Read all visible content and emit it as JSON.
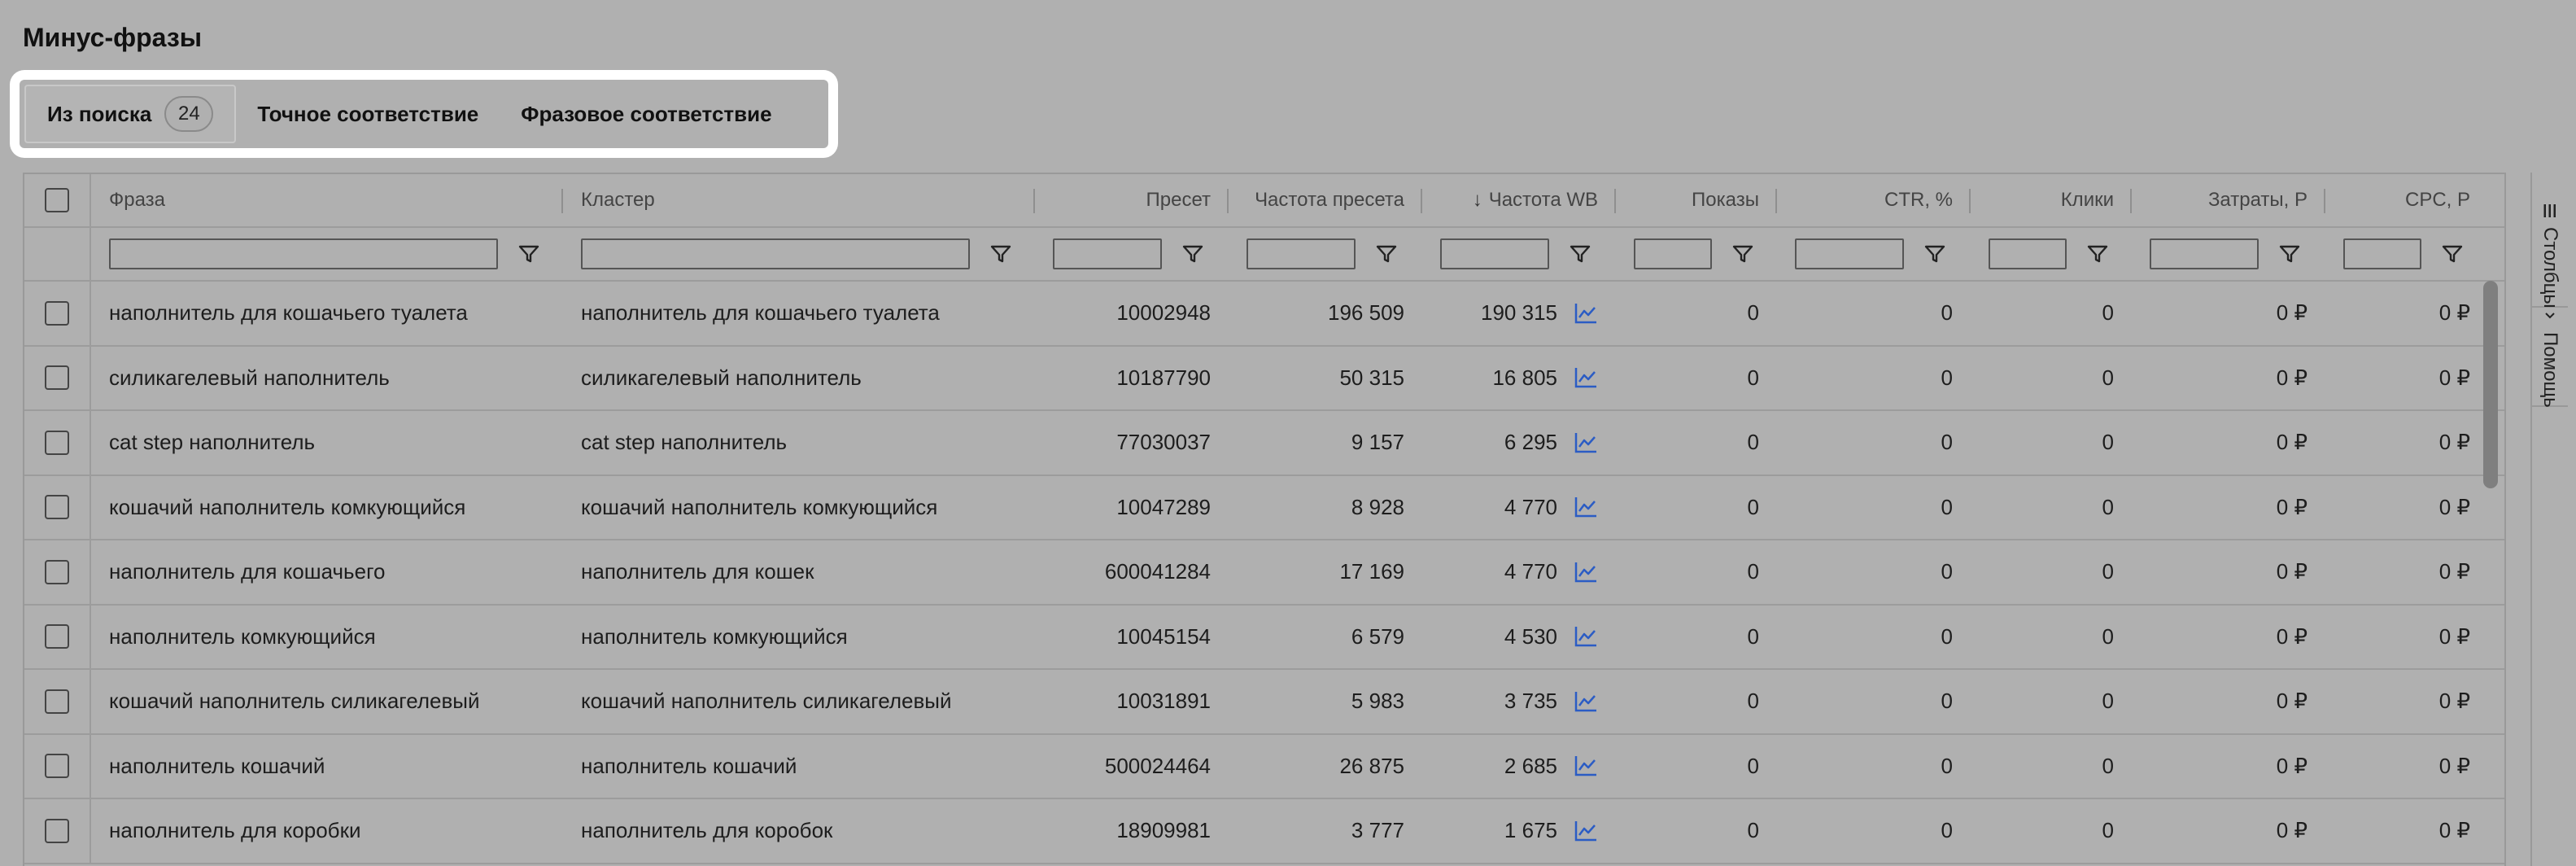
{
  "page": {
    "title": "Минус-фразы"
  },
  "tabs": [
    {
      "label": "Из поиска",
      "badge": "24",
      "active": true
    },
    {
      "label": "Точное соответствие",
      "active": false
    },
    {
      "label": "Фразовое соответствие",
      "active": false
    }
  ],
  "table": {
    "columns": [
      {
        "key": "phrase",
        "label": "Фраза"
      },
      {
        "key": "cluster",
        "label": "Кластер"
      },
      {
        "key": "preset",
        "label": "Пресет"
      },
      {
        "key": "preset_freq",
        "label": "Частота пресета"
      },
      {
        "key": "wb_freq",
        "label": "Частота WB",
        "sorted": "desc"
      },
      {
        "key": "impressions",
        "label": "Показы"
      },
      {
        "key": "ctr",
        "label": "CTR, %"
      },
      {
        "key": "clicks",
        "label": "Клики"
      },
      {
        "key": "cost",
        "label": "Затраты, Р"
      },
      {
        "key": "cpc",
        "label": "CPC, Р"
      }
    ],
    "sort_arrow": "↓",
    "rows": [
      [
        "наполнитель для кошачьего туалета",
        "наполнитель для кошачьего туалета",
        "10002948",
        "196 509",
        "190 315",
        "0",
        "0",
        "0",
        "0 ₽",
        "0 ₽"
      ],
      [
        "силикагелевый наполнитель",
        "силикагелевый наполнитель",
        "10187790",
        "50 315",
        "16 805",
        "0",
        "0",
        "0",
        "0 ₽",
        "0 ₽"
      ],
      [
        "cat step наполнитель",
        "cat step наполнитель",
        "77030037",
        "9 157",
        "6 295",
        "0",
        "0",
        "0",
        "0 ₽",
        "0 ₽"
      ],
      [
        "кошачий наполнитель комкующийся",
        "кошачий наполнитель комкующийся",
        "10047289",
        "8 928",
        "4 770",
        "0",
        "0",
        "0",
        "0 ₽",
        "0 ₽"
      ],
      [
        "наполнитель для кошачьего",
        "наполнитель для кошек",
        "600041284",
        "17 169",
        "4 770",
        "0",
        "0",
        "0",
        "0 ₽",
        "0 ₽"
      ],
      [
        "наполнитель комкующийся",
        "наполнитель комкующийся",
        "10045154",
        "6 579",
        "4 530",
        "0",
        "0",
        "0",
        "0 ₽",
        "0 ₽"
      ],
      [
        "кошачий наполнитель силикагелевый",
        "кошачий наполнитель силикагелевый",
        "10031891",
        "5 983",
        "3 735",
        "0",
        "0",
        "0",
        "0 ₽",
        "0 ₽"
      ],
      [
        "наполнитель кошачий",
        "наполнитель кошачий",
        "500024464",
        "26 875",
        "2 685",
        "0",
        "0",
        "0",
        "0 ₽",
        "0 ₽"
      ],
      [
        "наполнитель для коробки",
        "наполнитель для коробок",
        "18909981",
        "3 777",
        "1 675",
        "0",
        "0",
        "0",
        "0 ₽",
        "0 ₽"
      ]
    ]
  },
  "sidebar": {
    "columns_label": "Столбцы",
    "help_label": "Помощь"
  },
  "icons": {
    "filter": "filter-icon",
    "trend": "trend-chart-icon",
    "columns": "columns-icon",
    "help": "chevron-icon"
  },
  "colors": {
    "background": "#b0b0b0",
    "trend_icon": "#2b5cc4",
    "tabs_frame": "#ffffff"
  }
}
